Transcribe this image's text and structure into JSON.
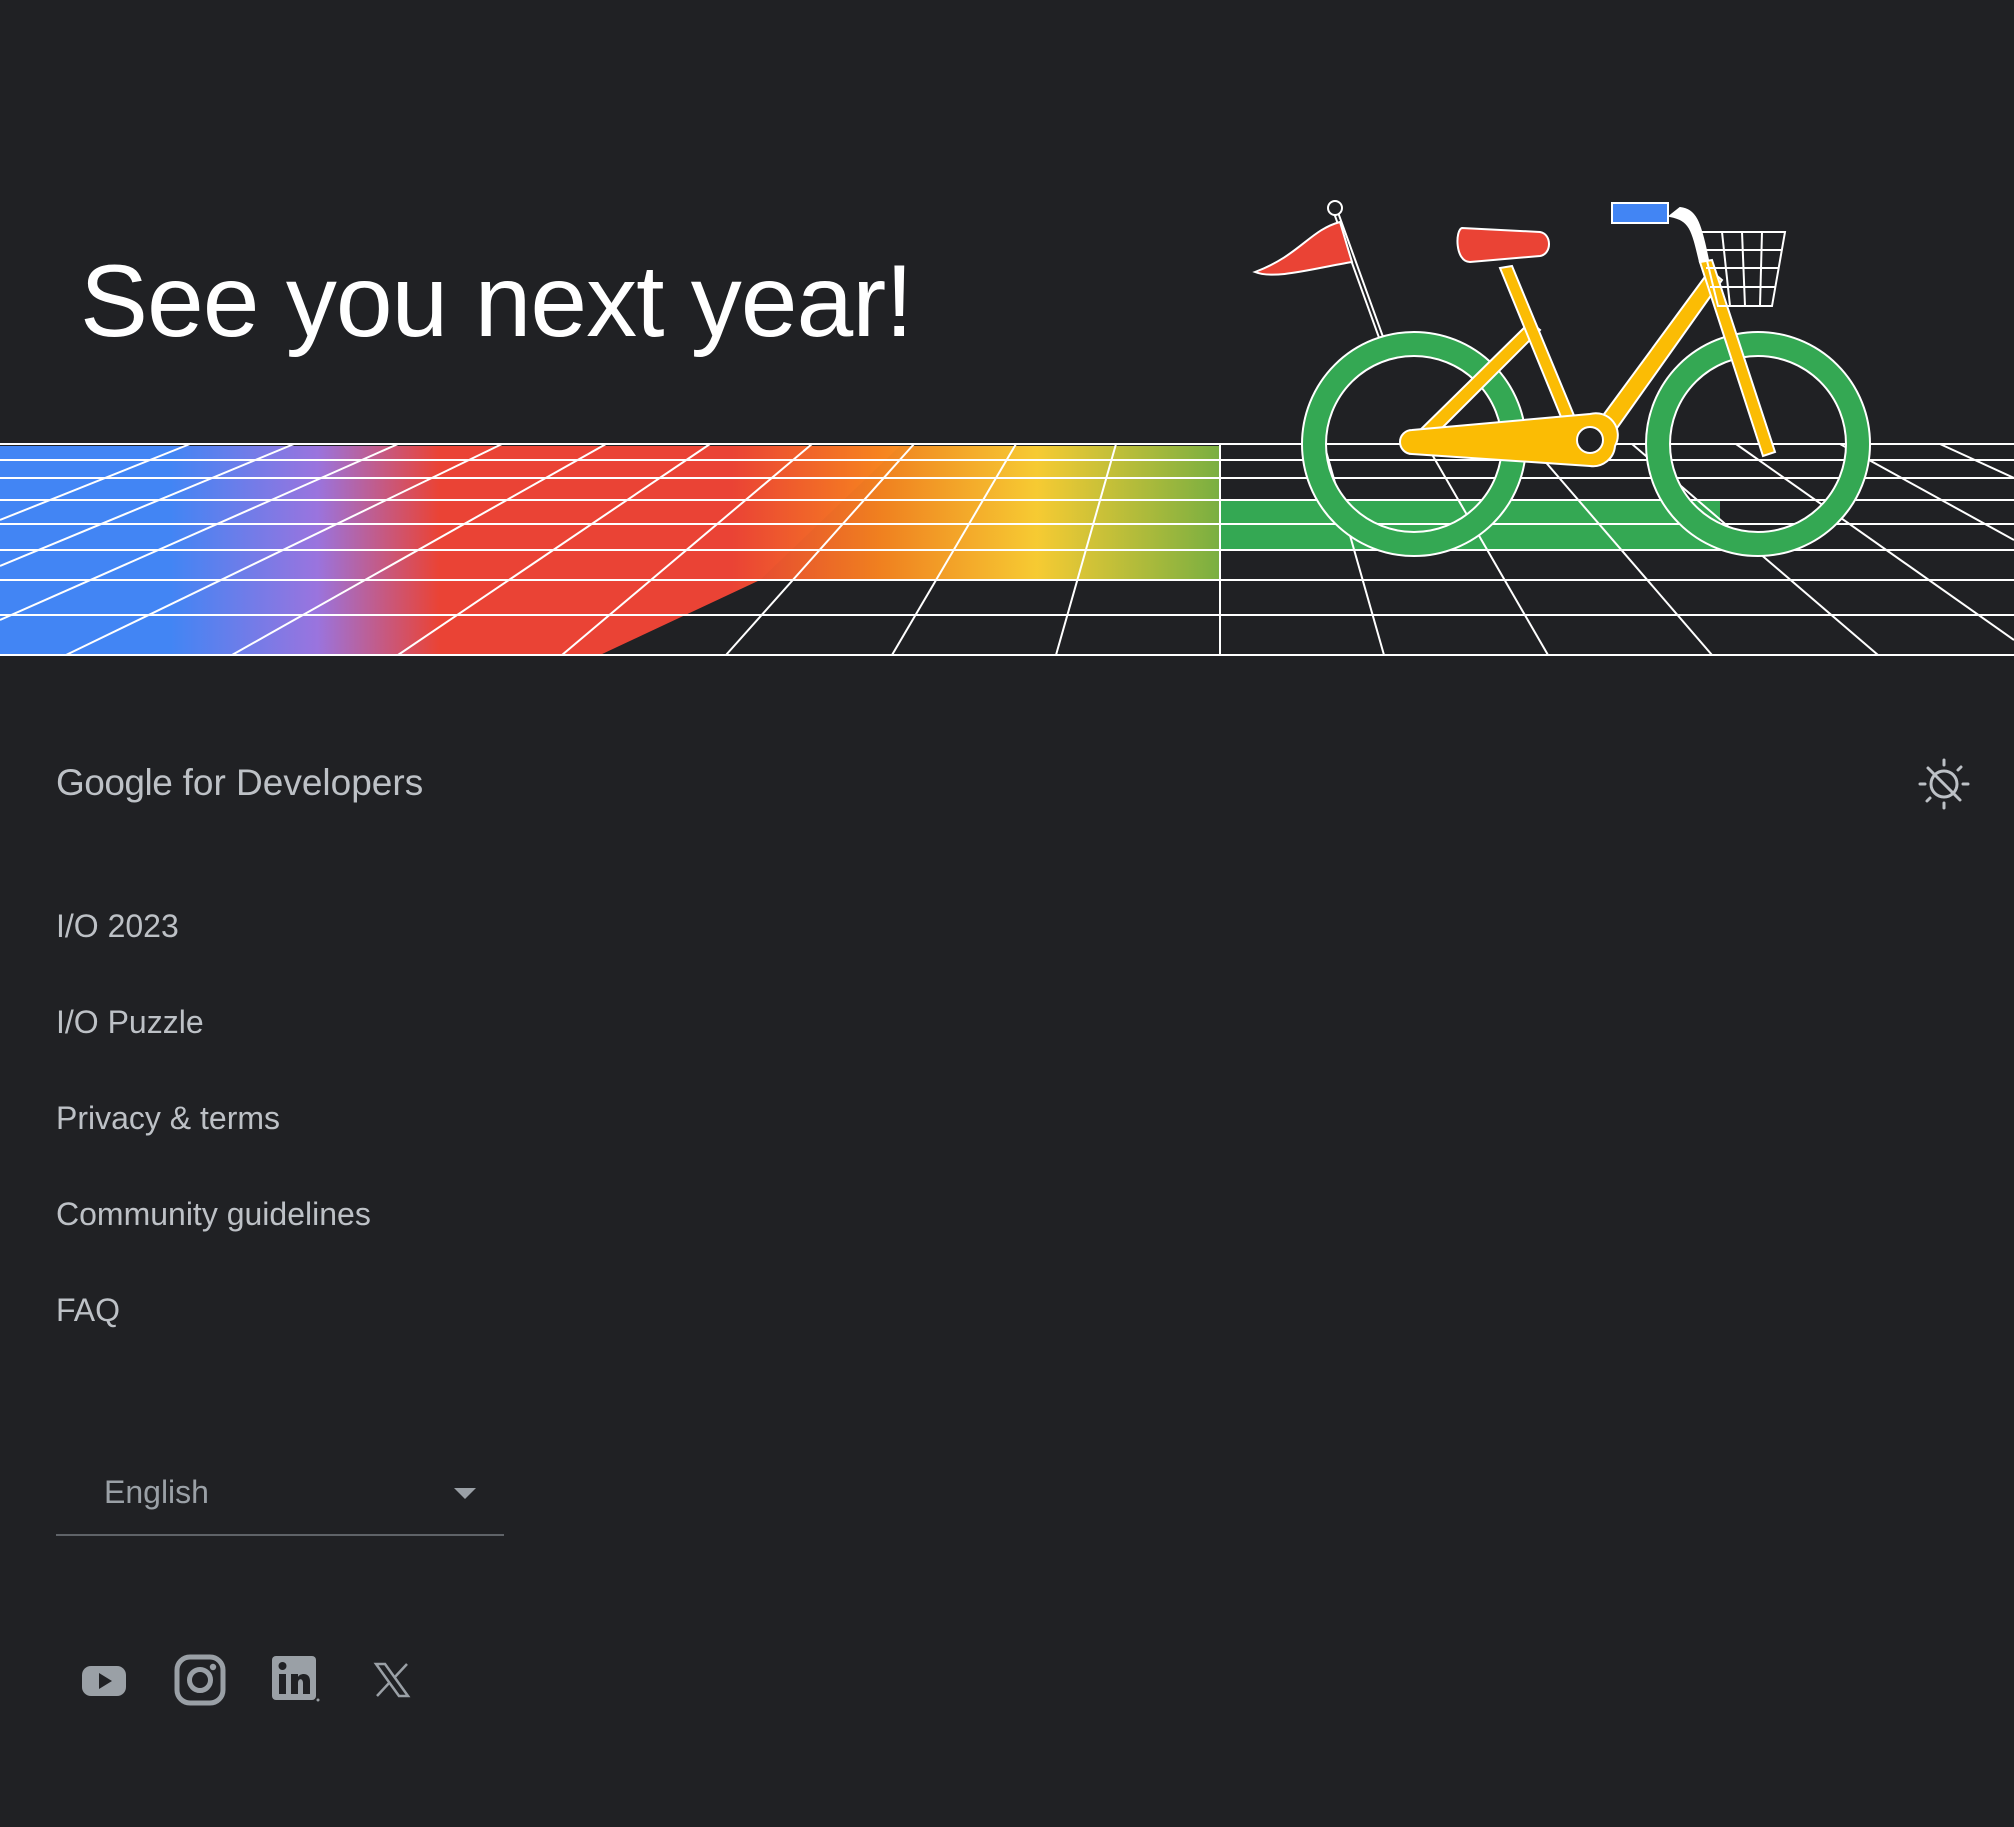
{
  "hero": {
    "title": "See you next year!"
  },
  "brand": {
    "google": "Google",
    "suffix": "for Developers"
  },
  "footer": {
    "links": [
      {
        "label": "I/O 2023"
      },
      {
        "label": "I/O Puzzle"
      },
      {
        "label": "Privacy & terms"
      },
      {
        "label": "Community guidelines"
      },
      {
        "label": "FAQ"
      }
    ]
  },
  "language": {
    "selected": "English"
  },
  "social": [
    {
      "name": "youtube-icon"
    },
    {
      "name": "instagram-icon"
    },
    {
      "name": "linkedin-icon"
    },
    {
      "name": "x-icon"
    }
  ],
  "colors": {
    "background": "#202124",
    "blue": "#4285f4",
    "purple": "#9a74de",
    "red": "#ea4335",
    "orange": "#f6821f",
    "yellow": "#fbbc04",
    "green": "#34a853",
    "text": "#bdc1c6"
  }
}
